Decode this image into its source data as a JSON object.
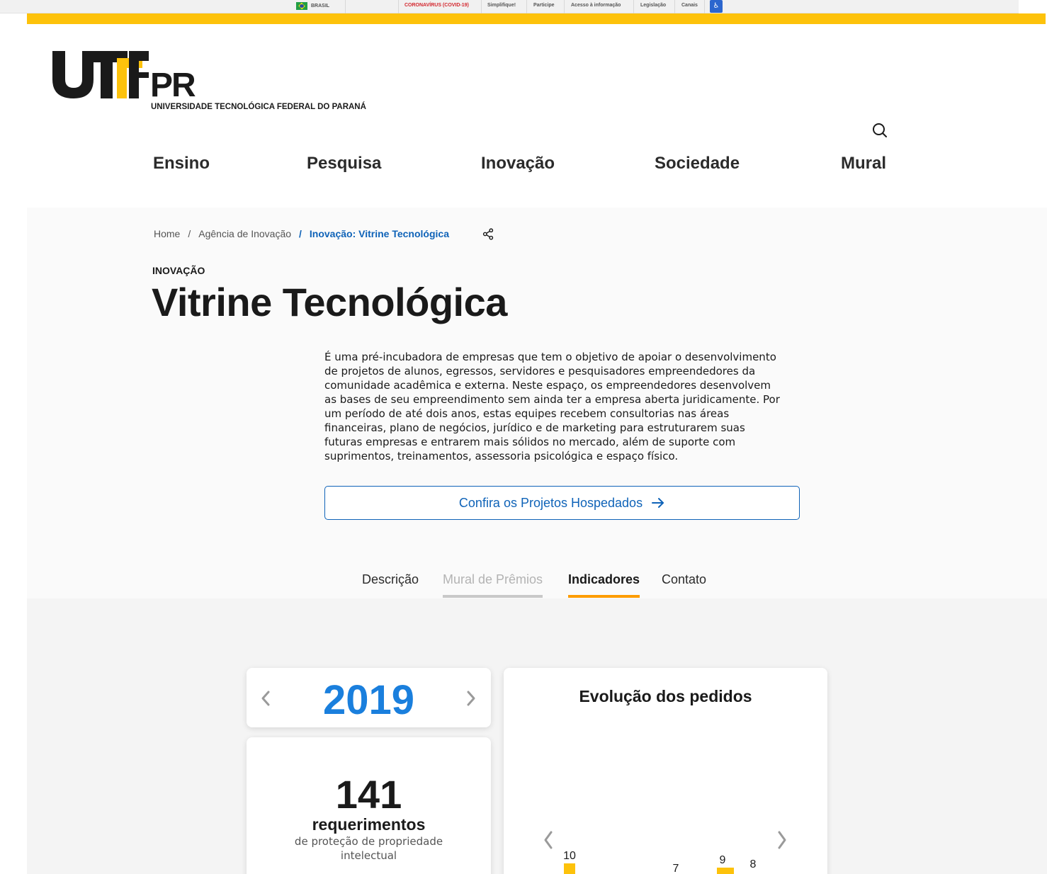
{
  "gov_bar": {
    "country": "BRASIL",
    "links": [
      "CORONAVÍRUS (COVID-19)",
      "Simplifique!",
      "Participe",
      "Acesso à informação",
      "Legislação",
      "Canais"
    ],
    "highlight_color": "#d3272e"
  },
  "brand": {
    "logo_letters": "UTFPR",
    "full_name": "UNIVERSIDADE TECNOLÓGICA FEDERAL DO PARANÁ",
    "accent_color": "#fdc20b"
  },
  "nav": {
    "items": [
      "Ensino",
      "Pesquisa",
      "Inovação",
      "Sociedade",
      "Mural"
    ]
  },
  "breadcrumb": {
    "items": [
      "Home",
      "Agência de Inovação",
      "Inovação: Vitrine Tecnológica"
    ],
    "separator": "/"
  },
  "page": {
    "kicker": "INOVAÇÃO",
    "title": "Vitrine Tecnológica",
    "description": "É uma pré-incubadora de empresas que tem o objetivo de apoiar o desenvolvimento de projetos de alunos, egressos, servidores e pesquisadores empreendedores da comunidade acadêmica e externa. Neste espaço, os empreendedores desenvolvem as bases de seu empreendimento sem ainda ter a empresa aberta juridicamente. Por um período de até dois anos, estas equipes recebem consultorias nas áreas financeiras, plano de negócios, jurídico e de marketing para estruturarem suas futuras empresas e entrarem mais sólidos no mercado, além de suporte com suprimentos, treinamentos, assessoria psicológica e espaço físico.",
    "cta_label": "Confira os Projetos Hospedados",
    "link_color": "#0f63b8"
  },
  "tabs": [
    {
      "label": "Descrição",
      "state": "normal"
    },
    {
      "label": "Mural de Prêmios",
      "state": "disabled"
    },
    {
      "label": "Indicadores",
      "state": "active"
    },
    {
      "label": "Contato",
      "state": "normal"
    }
  ],
  "indicators": {
    "year": "2019",
    "count": "141",
    "count_label": "requerimentos",
    "count_sub": "de proteção de propriedade intelectual",
    "year_color": "#1a7fdd"
  },
  "chart_data": {
    "type": "bar",
    "title": "Evolução dos pedidos",
    "visible_value_labels": [
      "10",
      "7",
      "9",
      "8"
    ],
    "values": [
      10,
      7,
      9,
      8
    ],
    "bar_color": "#fdc20b",
    "note_cropped": true
  }
}
